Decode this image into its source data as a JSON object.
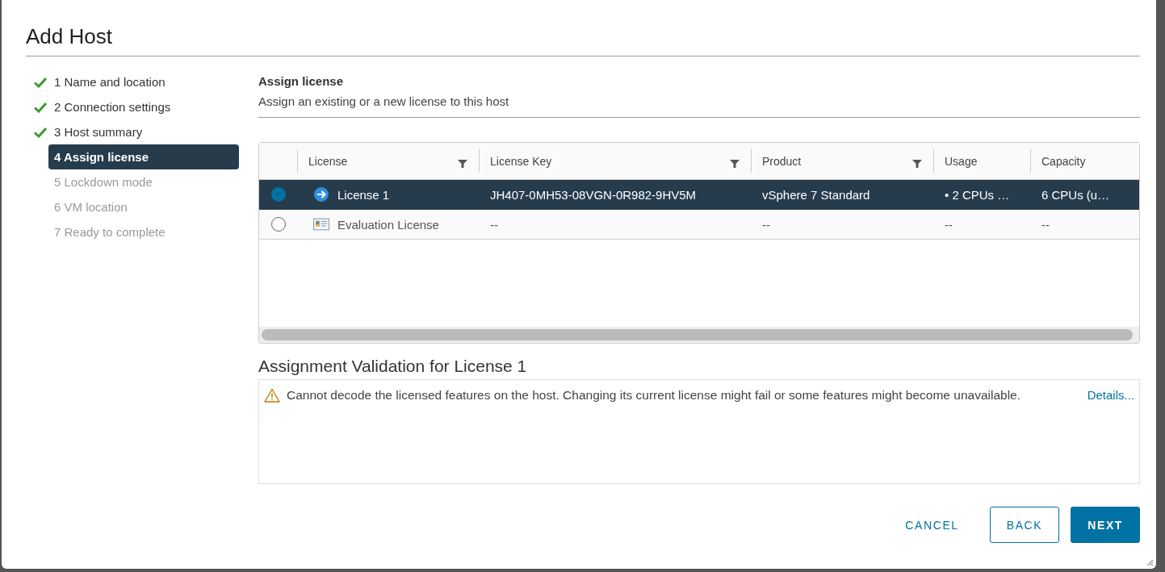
{
  "dialog": {
    "title": "Add Host"
  },
  "steps": [
    {
      "label": "1 Name and location",
      "completed": true,
      "selected": false
    },
    {
      "label": "2 Connection settings",
      "completed": true,
      "selected": false
    },
    {
      "label": "3 Host summary",
      "completed": true,
      "selected": false
    },
    {
      "label": "4 Assign license",
      "completed": false,
      "selected": true
    },
    {
      "label": "5 Lockdown mode",
      "completed": false,
      "selected": false
    },
    {
      "label": "6 VM location",
      "completed": false,
      "selected": false
    },
    {
      "label": "7 Ready to complete",
      "completed": false,
      "selected": false
    }
  ],
  "section": {
    "title": "Assign license",
    "subtitle": "Assign an existing or a new license to this host"
  },
  "table": {
    "columns": [
      {
        "label": "License",
        "filterable": true
      },
      {
        "label": "License Key",
        "filterable": true
      },
      {
        "label": "Product",
        "filterable": true
      },
      {
        "label": "Usage",
        "filterable": false
      },
      {
        "label": "Capacity",
        "filterable": false
      }
    ],
    "rows": [
      {
        "selected": true,
        "kind": "assigned",
        "cells": [
          "License 1",
          "JH407-0MH53-08VGN-0R982-9HV5M",
          "vSphere 7 Standard",
          "• 2 CPUs …",
          "6 CPUs (u…"
        ]
      },
      {
        "selected": false,
        "kind": "evaluation",
        "cells": [
          "Evaluation License",
          "--",
          "--",
          "--",
          "--"
        ]
      }
    ]
  },
  "validation": {
    "title": "Assignment Validation for License 1",
    "message": "Cannot decode the licensed features on the host. Changing its current license might fail or some features might become unavailable.",
    "link": "Details..."
  },
  "buttons": [
    {
      "label": "CANCEL",
      "kind": "flat"
    },
    {
      "label": "BACK",
      "kind": "outline"
    },
    {
      "label": "NEXT",
      "kind": "primary"
    }
  ]
}
